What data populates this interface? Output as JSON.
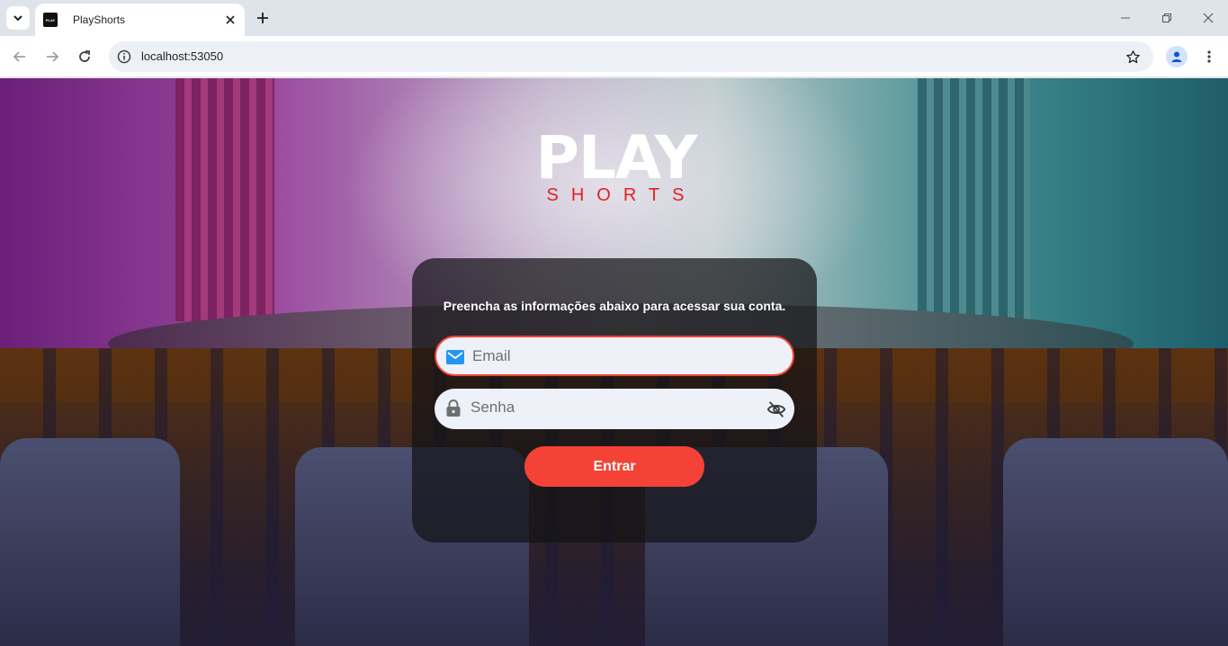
{
  "browser": {
    "tab_title": "PlayShorts",
    "favicon_text": "PLAY",
    "url": "localhost:53050"
  },
  "icons": {
    "tab_search": "chevron-down-icon",
    "close_tab": "close-icon",
    "new_tab": "plus-icon",
    "minimize": "minimize-icon",
    "restore": "restore-icon",
    "close_window": "close-icon",
    "back": "arrow-left-icon",
    "forward": "arrow-right-icon",
    "reload": "reload-icon",
    "site_info": "info-icon",
    "bookmark": "star-icon",
    "profile": "person-icon",
    "menu": "more-vertical-icon",
    "email": "mail-icon",
    "password": "lock-icon",
    "toggle_password": "eye-off-icon"
  },
  "logo": {
    "play": "PLAY",
    "shorts": "SHORTS"
  },
  "login": {
    "message": "Preencha as informações abaixo para acessar sua conta.",
    "email_placeholder": "Email",
    "password_placeholder": "Senha",
    "submit_label": "Entrar"
  },
  "colors": {
    "accent": "#f44336",
    "logo_red": "#e32020",
    "email_icon": "#2196f3",
    "card_bg": "rgba(20,20,22,0.72)"
  }
}
